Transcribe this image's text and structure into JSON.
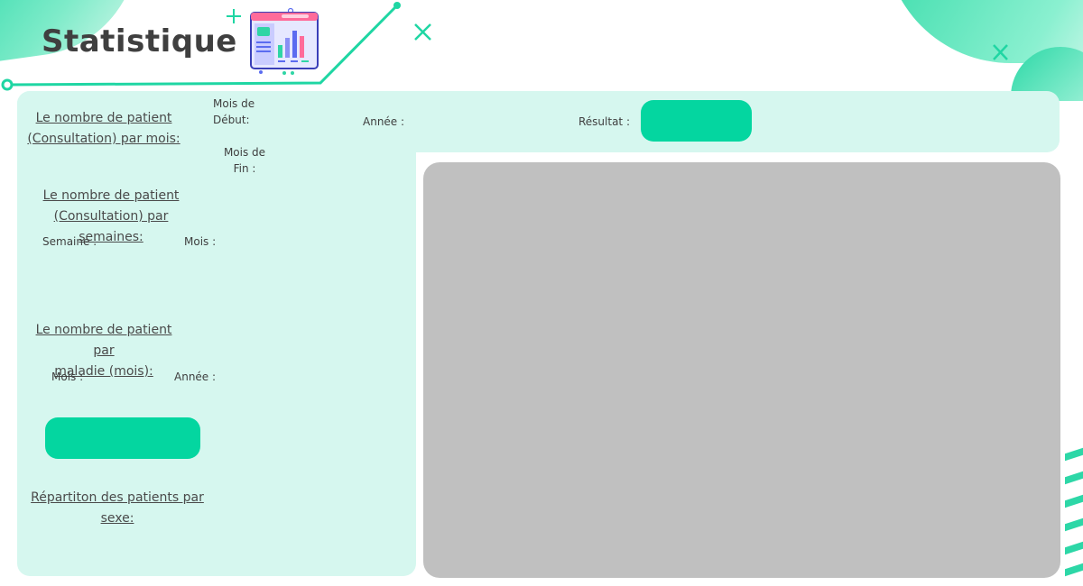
{
  "page": {
    "title": "Statistique",
    "accent_color": "#04d6a0",
    "panel_color": "#d6f7ef",
    "chart_placeholder_color": "#c0c0c0"
  },
  "header_icon": "analytics-dashboard-icon",
  "monthly": {
    "heading_line1": "Le nombre de patient",
    "heading_line2": "(Consultation) par mois:",
    "start_month_label_line1": "Mois de",
    "start_month_label_line2": "Début:",
    "end_month_label_line1": "Mois de",
    "end_month_label_line2": "Fin :",
    "year_label": "Année :",
    "result_label": "Résultat :"
  },
  "weekly": {
    "heading_line1": "Le nombre de patient",
    "heading_line2": "(Consultation) par semaines:",
    "week_label": "Semaine :",
    "month_label": "Mois :"
  },
  "disease": {
    "heading_line1": "Le nombre de patient par",
    "heading_line2": "maladie (mois):",
    "month_label": "Mois :",
    "year_label": "Année :"
  },
  "gender": {
    "heading_line1": "Répartiton des patients par",
    "heading_line2": "sexe:"
  }
}
